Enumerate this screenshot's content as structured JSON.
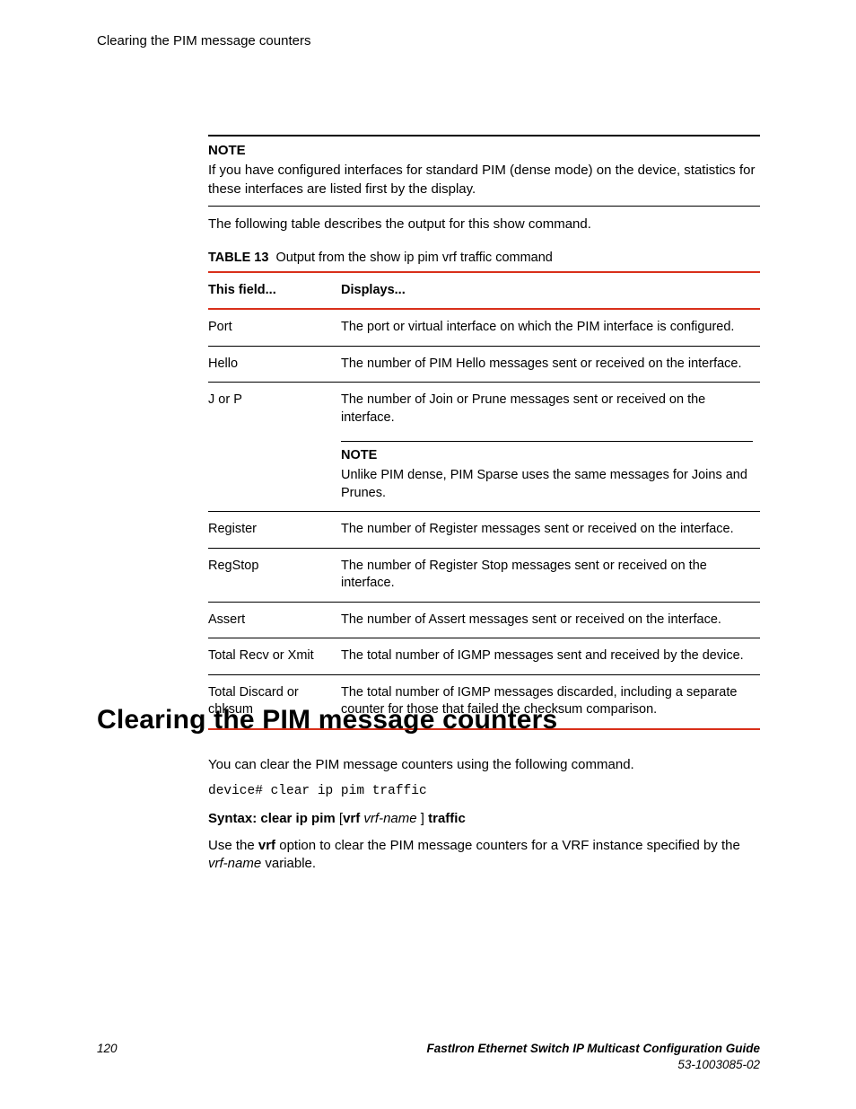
{
  "runningHead": "Clearing the PIM message counters",
  "noteBlock": {
    "label": "NOTE",
    "body": "If you have configured interfaces for standard PIM (dense mode) on the device, statistics for these interfaces are listed first by the display."
  },
  "introPara": "The following table describes the output for this show command.",
  "tableCaption": {
    "prefix": "TABLE 13",
    "title": "Output from the show ip pim vrf traffic command"
  },
  "tableHeaders": {
    "field": "This field...",
    "desc": "Displays..."
  },
  "rows": [
    {
      "field": "Port",
      "desc": "The port or virtual interface on which the PIM interface is configured."
    },
    {
      "field": "Hello",
      "desc": "The number of PIM Hello messages sent or received on the interface."
    },
    {
      "field": "J or P",
      "desc": "The number of Join or Prune messages sent or received on the interface.",
      "note": {
        "label": "NOTE",
        "body": "Unlike PIM dense, PIM Sparse uses the same messages for Joins and Prunes."
      }
    },
    {
      "field": "Register",
      "desc": "The number of Register messages sent or received on the interface."
    },
    {
      "field": "RegStop",
      "desc": "The number of Register Stop messages sent or received on the interface."
    },
    {
      "field": "Assert",
      "desc": "The number of Assert messages sent or received on the interface."
    },
    {
      "field": "Total Recv or Xmit",
      "desc": "The total number of IGMP messages sent and received by the device."
    },
    {
      "field": "Total Discard or chksum",
      "desc": "The total number of IGMP messages discarded, including a separate counter for those that failed the checksum comparison."
    }
  ],
  "sectionHeading": "Clearing the PIM message counters",
  "bodyPara1": "You can clear the PIM message counters using the following command.",
  "codeLine": "device# clear ip pim traffic",
  "syntax": {
    "label": "Syntax: clear ip pim",
    "lbr": "[",
    "opt": "vrf",
    "arg": "vrf-name",
    "rbr": "]",
    "tail": "traffic"
  },
  "bodyPara2a": "Use the ",
  "bodyPara2b": "vrf",
  "bodyPara2c": " option to clear the PIM message counters for a VRF instance specified by the ",
  "bodyPara2d": "vrf-name",
  "bodyPara2e": " variable.",
  "footer": {
    "pageNum": "120",
    "docTitle": "FastIron Ethernet Switch IP Multicast Configuration Guide",
    "docNum": "53-1003085-02"
  }
}
